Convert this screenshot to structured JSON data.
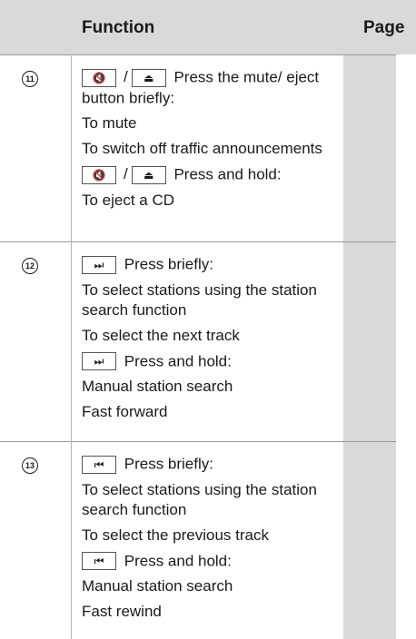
{
  "header": {
    "function_label": "Function",
    "page_label": "Page"
  },
  "rows": [
    {
      "number": "11",
      "lines": [
        {
          "type": "buttons",
          "icons": [
            "mute-icon",
            "eject-icon"
          ],
          "text": "Press the mute/ eject button briefly:"
        },
        {
          "type": "text",
          "text": "To mute"
        },
        {
          "type": "text",
          "text": "To switch off traffic announcements"
        },
        {
          "type": "buttons",
          "icons": [
            "mute-icon",
            "eject-icon"
          ],
          "text": "Press and hold:"
        },
        {
          "type": "text",
          "text": "To eject a CD"
        }
      ]
    },
    {
      "number": "12",
      "lines": [
        {
          "type": "buttons",
          "icons": [
            "skip-forward-icon"
          ],
          "text": "Press briefly:"
        },
        {
          "type": "text",
          "text": "To select stations using the station search function"
        },
        {
          "type": "text",
          "text": "To select the next track"
        },
        {
          "type": "buttons",
          "icons": [
            "skip-forward-icon"
          ],
          "text": "Press and hold:"
        },
        {
          "type": "text",
          "text": "Manual station search"
        },
        {
          "type": "text",
          "text": "Fast forward"
        }
      ]
    },
    {
      "number": "13",
      "lines": [
        {
          "type": "buttons",
          "icons": [
            "skip-back-icon"
          ],
          "text": "Press briefly:"
        },
        {
          "type": "text",
          "text": "To select stations using the station search function"
        },
        {
          "type": "text",
          "text": "To select the previous track"
        },
        {
          "type": "buttons",
          "icons": [
            "skip-back-icon"
          ],
          "text": "Press and hold:"
        },
        {
          "type": "text",
          "text": "Manual station search"
        },
        {
          "type": "text",
          "text": "Fast rewind"
        }
      ]
    }
  ]
}
